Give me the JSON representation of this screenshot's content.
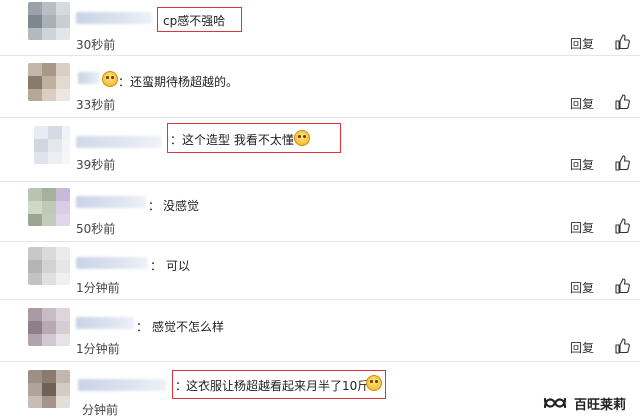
{
  "actions": {
    "reply_label": "回复"
  },
  "comments": [
    {
      "text": "cp感不强哈",
      "prefix": "",
      "time": "30秒前",
      "emoji": false,
      "highlight": true
    },
    {
      "text": "还蛮期待杨超越的。",
      "prefix": "：",
      "time": "33秒前",
      "emoji": false,
      "highlight": false
    },
    {
      "text": "这个造型 我看不太懂",
      "prefix": "：",
      "time": "39秒前",
      "emoji": true,
      "highlight": true
    },
    {
      "text": "没感觉",
      "prefix": "：",
      "time": "50秒前",
      "emoji": false,
      "highlight": false
    },
    {
      "text": "可以",
      "prefix": "：",
      "time": "1分钟前",
      "emoji": false,
      "highlight": false
    },
    {
      "text": "感觉不怎么样",
      "prefix": "：",
      "time": "1分钟前",
      "emoji": false,
      "highlight": false
    },
    {
      "text": "这衣服让杨超越看起来月半了10斤",
      "prefix": "：",
      "time": "分钟前",
      "emoji": true,
      "highlight": true
    }
  ],
  "watermark": {
    "text": "百旺莱莉",
    "icon": "wechat-channel-icon"
  },
  "colors": {
    "highlight": "#e0323a",
    "divider": "#e6e6e6"
  }
}
